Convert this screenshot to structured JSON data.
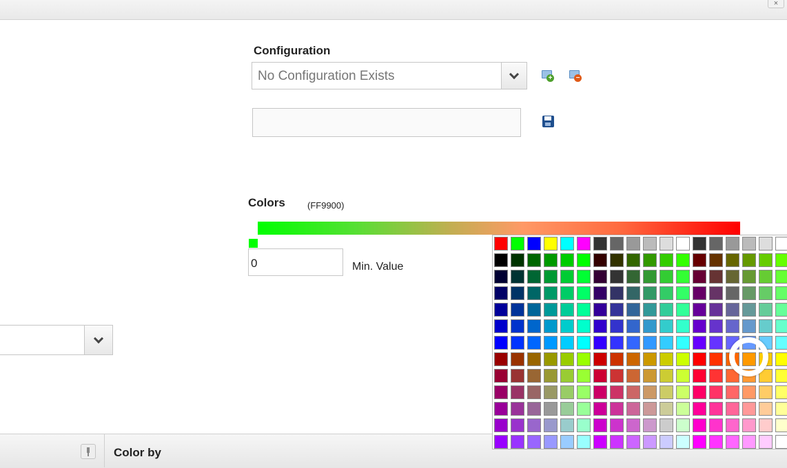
{
  "window": {
    "close_label": "×"
  },
  "configuration": {
    "title": "Configuration",
    "selected": "No Configuration Exists",
    "name_value": ""
  },
  "colors": {
    "title": "Colors",
    "selected_hex": "(FF9900)",
    "gradient_start": "#00FF00",
    "gradient_mid": "#FF9966",
    "gradient_end": "#FF0000",
    "min_value": "0",
    "min_label": "Min. Value"
  },
  "bottom_panel": {
    "title": "Color by"
  },
  "palette": {
    "selected_color": "#FF9900",
    "top_row": [
      "#FF0000",
      "#00FF00",
      "#0000FF",
      "#FFFF00",
      "#00FFFF",
      "#FF00FF",
      "#333333",
      "#666666",
      "#999999",
      "#BBBBBB",
      "#DDDDDD",
      "#FFFFFF",
      "#333333",
      "#666666",
      "#999999",
      "#BBBBBB",
      "#DDDDDD",
      "#FFFFFF"
    ],
    "grid_r": [
      "00",
      "33",
      "66",
      "99",
      "CC",
      "FF"
    ],
    "grid_g": [
      "00",
      "33",
      "66",
      "99",
      "CC",
      "FF"
    ],
    "grid_b": [
      "00",
      "33",
      "66",
      "99",
      "CC",
      "FF"
    ]
  }
}
